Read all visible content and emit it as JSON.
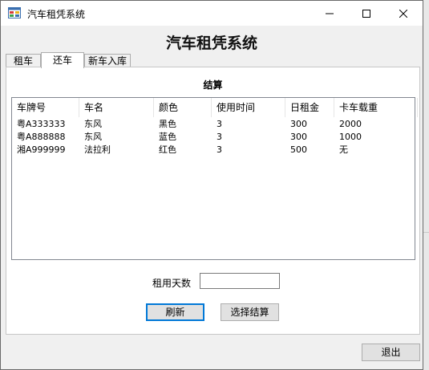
{
  "window": {
    "title": "汽车租凭系统"
  },
  "app": {
    "heading": "汽车租凭系统"
  },
  "tabs": [
    {
      "label": "租车"
    },
    {
      "label": "还车"
    },
    {
      "label": "新车入库"
    }
  ],
  "active_tab": "还车",
  "panel": {
    "section_title": "结算",
    "columns": [
      "车牌号",
      "车名",
      "颜色",
      "使用时间",
      "日租金",
      "卡车载重"
    ],
    "rows": [
      [
        "粤A333333",
        "东风",
        "黑色",
        "3",
        "300",
        "2000"
      ],
      [
        "粤A888888",
        "东风",
        "蓝色",
        "3",
        "300",
        "1000"
      ],
      [
        "湘A999999",
        "法拉利",
        "红色",
        "3",
        "500",
        "无"
      ]
    ],
    "days_label": "租用天数",
    "days_value": "",
    "refresh_label": "刷新",
    "settle_label": "选择结算"
  },
  "footer": {
    "exit_label": "退出"
  },
  "colors": {
    "accent": "#0078d7",
    "window_bg": "#f0f0f0"
  },
  "icons": {
    "app": "car-rental-app-icon",
    "minimize": "minimize-icon",
    "maximize": "maximize-icon",
    "close": "close-icon"
  }
}
